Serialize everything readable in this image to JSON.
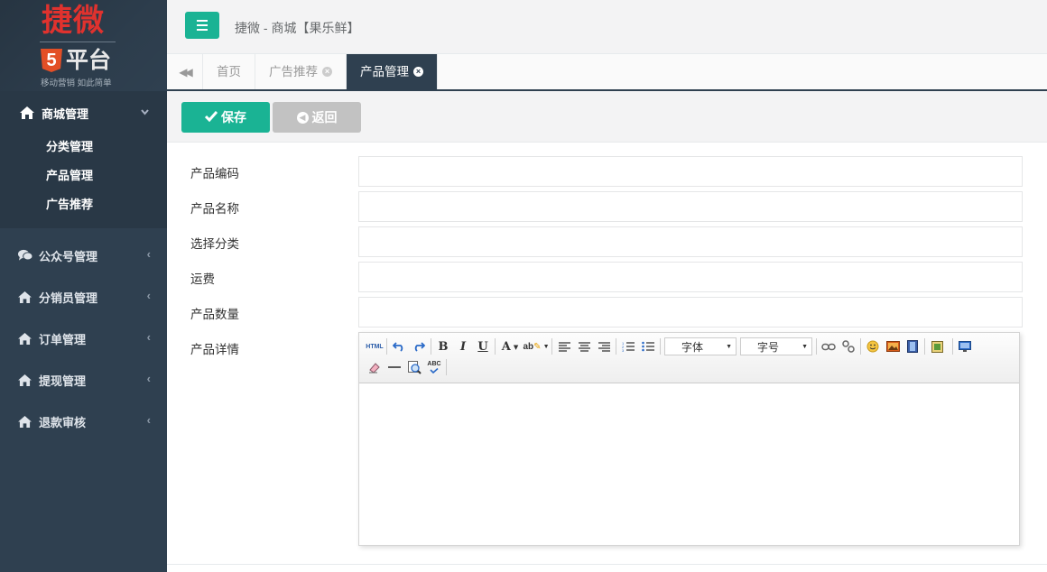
{
  "logo": {
    "main": "捷微",
    "h5": "5",
    "sub": "平台",
    "tagline": "移动营销 如此简单"
  },
  "sidebar": {
    "open_group": {
      "label": "商城管理",
      "items": [
        "分类管理",
        "产品管理",
        "广告推荐"
      ]
    },
    "items": [
      {
        "label": "公众号管理",
        "icon": "comments-icon"
      },
      {
        "label": "分销员管理",
        "icon": "home-icon"
      },
      {
        "label": "订单管理",
        "icon": "home-icon"
      },
      {
        "label": "提现管理",
        "icon": "home-icon"
      },
      {
        "label": "退款审核",
        "icon": "home-icon"
      }
    ]
  },
  "header": {
    "title": "捷微 - 商城【果乐鲜】"
  },
  "tabs": [
    {
      "label": "首页",
      "closable": false,
      "active": false
    },
    {
      "label": "广告推荐",
      "closable": true,
      "active": false
    },
    {
      "label": "产品管理",
      "closable": true,
      "active": true
    }
  ],
  "toolbar": {
    "save_label": "保存",
    "back_label": "返回"
  },
  "form": {
    "labels": [
      "产品编码",
      "产品名称",
      "选择分类",
      "运费",
      "产品数量",
      "产品详情"
    ],
    "values": [
      "",
      "",
      "",
      "",
      ""
    ]
  },
  "editor": {
    "font_family": "字体",
    "font_size": "字号",
    "html_label": "HTML",
    "abc_label": "ABC",
    "body": ""
  },
  "colors": {
    "sidebar": "#2f4050",
    "accent": "#1ab394",
    "back_button": "#c2c2c2"
  }
}
